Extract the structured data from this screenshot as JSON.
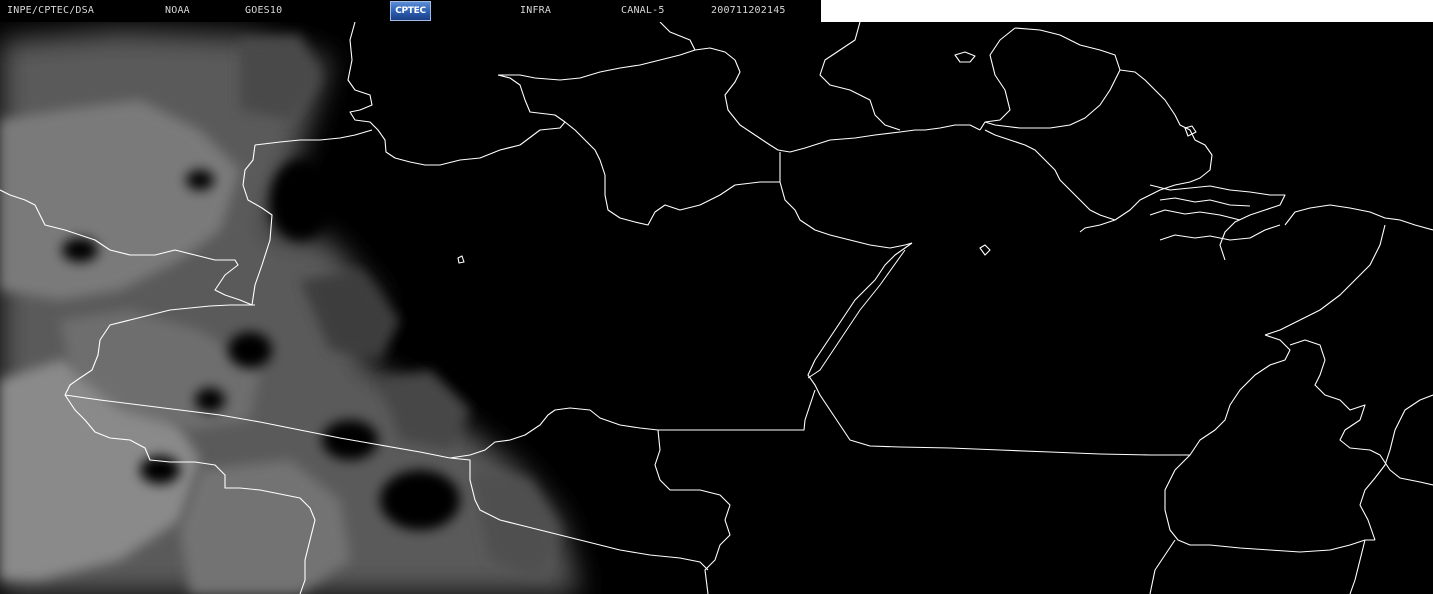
{
  "header": {
    "institution": "INPE/CPTEC/DSA",
    "agency": "NOAA",
    "satellite": "GOES10",
    "logo_text": "CPTEC",
    "band": "INFRA",
    "channel": "CANAL-5",
    "timestamp": "200711202145"
  },
  "colors": {
    "background": "#000000",
    "borders": "#ffffff",
    "header_text": "#d8d8d8",
    "logo_blue": "#2b5eb0",
    "cloud_gray": "#9a9a9a"
  },
  "icons": {
    "logo": "cptec-logo"
  }
}
